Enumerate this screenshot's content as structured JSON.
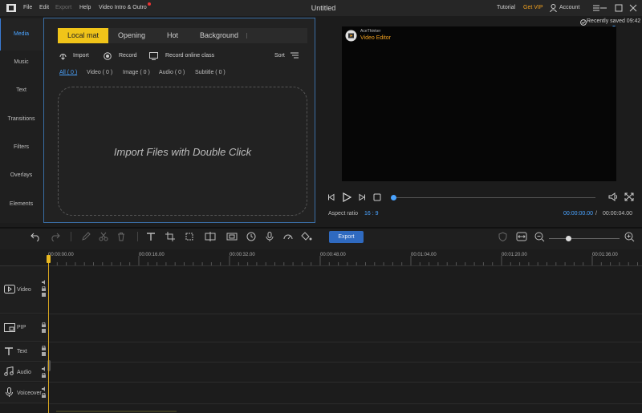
{
  "menu": {
    "file": "File",
    "edit": "Edit",
    "export": "Export",
    "help": "Help",
    "intro": "Video Intro & Outro"
  },
  "title": "Untitled",
  "header_right": {
    "tutorial": "Tutorial",
    "vip": "Get VIP",
    "account": "Account"
  },
  "nav": [
    "Media",
    "Music",
    "Text",
    "Transitions",
    "Filters",
    "Overlays",
    "Elements"
  ],
  "tabs": [
    "Local mat",
    "Opening",
    "Hot",
    "Background"
  ],
  "tools": {
    "import": "Import",
    "record": "Record",
    "record_online": "Record online class",
    "sort": "Sort"
  },
  "filters": [
    "All ( 0 )",
    "Video ( 0 )",
    "Image ( 0 )",
    "Audio ( 0 )",
    "Subtitle ( 0 )"
  ],
  "dropzone_text": "Import Files with Double Click",
  "preview": {
    "saved": "Recently saved 09:42",
    "brand": "AceThinker",
    "product": "Video Editor",
    "aspect_label": "Aspect ratio",
    "aspect_value": "16 : 9",
    "time_current": "00:00:00.00",
    "time_sep": "/",
    "time_total": "00:00:04.00"
  },
  "timeline": {
    "export_label": "Export",
    "ticks": [
      "00:00:00.00",
      "00:00:16.00",
      "00:00:32.00",
      "00:00:48.00",
      "00:01:04.00",
      "00:01:20.00",
      "00:01:36.00"
    ]
  },
  "tracks": [
    "Video",
    "PIP",
    "Text",
    "Audio",
    "Voiceover"
  ],
  "colors": {
    "accent": "#f0c419",
    "vip": "#f0a020",
    "blue": "#4aa3ff",
    "export_bg": "#2f6ac0"
  }
}
